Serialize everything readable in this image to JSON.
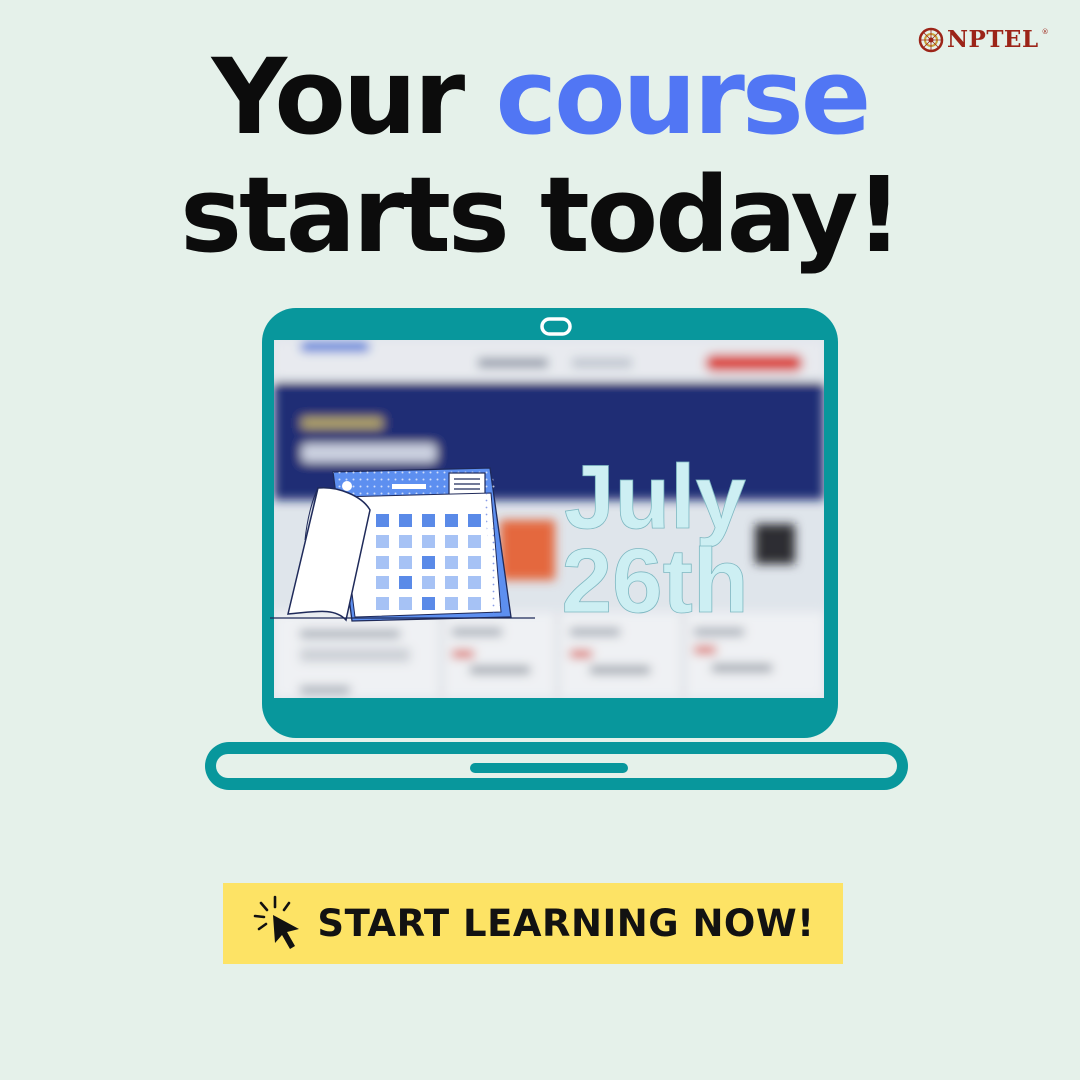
{
  "brand": {
    "name": "NPTEL",
    "logo_icon": "nptel-emblem-icon"
  },
  "headline": {
    "line1_prefix": "Your",
    "line1_accent": "course",
    "line2": "starts today!"
  },
  "date": {
    "month": "July",
    "day": "26th"
  },
  "cta": {
    "label": "START LEARNING NOW!",
    "icon": "cursor-click-icon"
  },
  "illustration": {
    "laptop_icon": "laptop-icon",
    "calendar_icon": "calendar-icon"
  },
  "colors": {
    "background": "#e5f1ea",
    "accent_blue": "#5176f4",
    "laptop_teal": "#08979c",
    "cta_yellow": "#fde365",
    "brand_red": "#9c2418",
    "date_text": "#cdeff3"
  }
}
